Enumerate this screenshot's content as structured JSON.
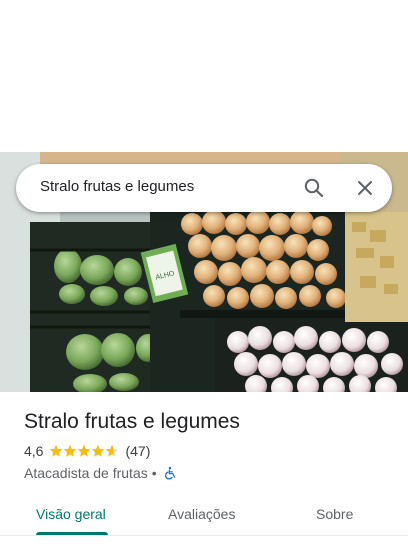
{
  "search": {
    "query": "Stralo frutas e legumes"
  },
  "hero": {
    "sign_text": "ALHO"
  },
  "place": {
    "name": "Stralo frutas e legumes",
    "rating": "4,6",
    "rating_stars": 4.6,
    "reviews_count": "(47)",
    "category": "Atacadista de frutas",
    "separator": "•",
    "accessibility_icon": "wheelchair-icon"
  },
  "tabs": [
    {
      "label": "Visão geral",
      "active": true
    },
    {
      "label": "Avaliações",
      "active": false
    },
    {
      "label": "Sobre",
      "active": false
    }
  ],
  "colors": {
    "accent": "#00796b",
    "star": "#fbbc04",
    "a11y_icon": "#1a73e8"
  }
}
